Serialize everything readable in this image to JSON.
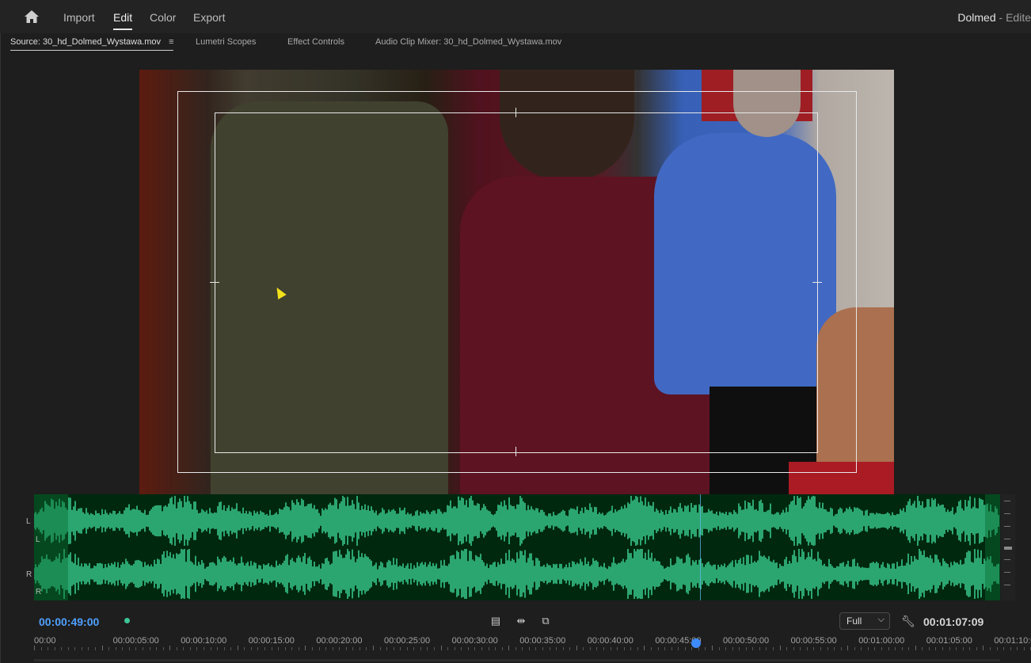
{
  "topbar": {
    "home_icon": "home-icon",
    "nav": [
      "Import",
      "Edit",
      "Color",
      "Export"
    ],
    "active": "Edit",
    "project_title": "Dolmed",
    "project_suffix": " - Edite"
  },
  "tabs": {
    "source": "Source: 30_hd_Dolmed_Wystawa.mov",
    "menu_icon": "≡",
    "lumetri": "Lumetri Scopes",
    "effect_controls": "Effect Controls",
    "audio_mixer": "Audio Clip Mixer: 30_hd_Dolmed_Wystawa.mov"
  },
  "audio": {
    "channel_left": "L",
    "channel_right": "R",
    "accent": "#3fdc9a",
    "background": "#00280f"
  },
  "transport": {
    "current_timecode": "00:00:49:00",
    "duration_timecode": "00:01:07:09",
    "zoom_value": "Full",
    "icons": [
      "insert-icon",
      "overwrite-icon",
      "export-frame-icon",
      "wrench-icon"
    ]
  },
  "ruler": {
    "labels": [
      "00:00",
      "00:00:05:00",
      "00:00:10:00",
      "00:00:15:00",
      "00:00:20:00",
      "00:00:25:00",
      "00:00:30:00",
      "00:00:35:00",
      "00:00:40:00",
      "00:00:45:00",
      "00:00:50:00",
      "00:00:55:00",
      "00:01:00:00",
      "00:01:05:00",
      "00:01:10:0"
    ]
  }
}
